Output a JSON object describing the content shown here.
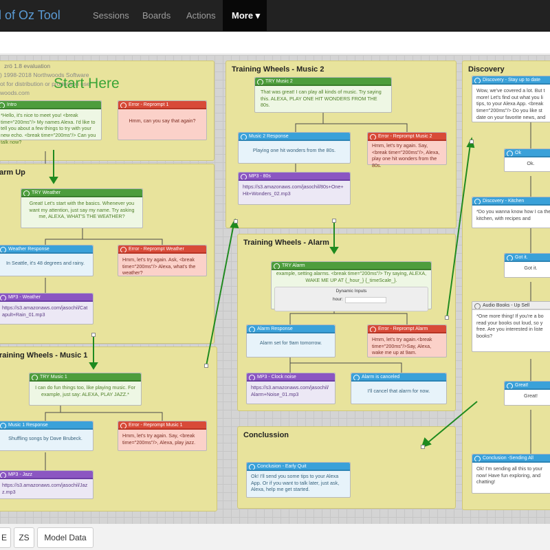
{
  "nav": {
    "brand": "d of Oz Tool",
    "items": [
      "Sessions",
      "Boards",
      "Actions"
    ],
    "active": "More ▾"
  },
  "canvas": {
    "meta": {
      "title": "zrö",
      "version": "1.8 evaluation",
      "copyright": ") 1998-2018 Northwoods Software",
      "note": "ot for distribution or production use",
      "url": "woods.com"
    },
    "start_here": "Start Here",
    "sections": {
      "intro": "",
      "alarm_up": "arm Up",
      "music1": "raining Wheels - Music 1",
      "music2": "Training Wheels - Music 2",
      "alarm": "Training Wheels - Alarm",
      "conclussion": "Conclussion",
      "discovery": "Discovery"
    },
    "cards": {
      "intro": {
        "title": "Intro",
        "body": "*Hello, it's nice to meet you! <break time=\"200ms\"/> My names Alexa. I'd like to tell you about a few things to try with your new echo. <break time=\"200ms\"/> Can you talk now?"
      },
      "err_reprompt": {
        "title": "Error - Reprompt 1",
        "body": "Hmm, can you say that again?"
      },
      "try_weather": {
        "title": "TRY Weather",
        "body": "Great! Let's start with the basics. Whenever you want my attention, just say my name. Try asking me, ALEXA, WHAT'S THE WEATHER?"
      },
      "weather_resp": {
        "title": "Weather Response",
        "body": "In Seattle, it's 48 degrees and rainy."
      },
      "err_weather": {
        "title": "Error - Reprompt Weather",
        "body": "Hmm, let's try again. Ask, <break time=\"200ms\"/> Alexa, what's the weather?"
      },
      "mp3_weather": {
        "title": "MP3 - Weather",
        "body": "https://s3.amazonaws.com/jasochil/Catapult+Rain_01.mp3"
      },
      "try_music1": {
        "title": "TRY Music 1",
        "body": "I can do fun things too, like playing music. For example, just say: ALEXA, PLAY JAZZ.*"
      },
      "music1_resp": {
        "title": "Music 1 Response",
        "body": "Shuffling songs by Dave Brubeck."
      },
      "err_music1": {
        "title": "Error - Reprompt Music 1",
        "body": "Hmm, let's try again. Say, <break time=\"200ms\"/>, Alexa, play jazz."
      },
      "mp3_jazz": {
        "title": "MP3 - Jazz",
        "body": "https://s3.amazonaws.com/jasochil/Jazz.mp3"
      },
      "try_music2": {
        "title": "TRY Music 2",
        "body": "That was great! I can play all kinds of music. Try saying this. ALEXA, PLAY ONE HIT WONDERS FROM THE 80s."
      },
      "music2_resp": {
        "title": "Music 2 Response",
        "body": "Playing one hit wonders from the 80s."
      },
      "err_music2": {
        "title": "Error - Reprompt Music 2",
        "body": "Hmm, let's try again. Say, <break time=\"200ms\"/>, Alexa, play one hit wonders from the 80s."
      },
      "mp3_80s": {
        "title": "MP3 - 80s",
        "body": "https://s3.amazonaws.com/jasochil/80s+One+Hit+Wonders_02.mp3"
      },
      "try_alarm": {
        "title": "TRY Alarm",
        "body": "example, setting alarms. <break time=\"200ms\"/> Try saying, ALEXA, WAKE ME UP AT {_hour_} {_timeScale_}.",
        "dyn_title": "Dynamic Inputs",
        "dyn_label": "hour:"
      },
      "alarm_resp": {
        "title": "Alarm Response",
        "body": "Alarm set for 9am tomorrow."
      },
      "err_alarm": {
        "title": "Error - Reprompt Alarm",
        "body": "Hmm, let's try again.<break time=\"200ms\"/>Say, Alexa, wake me up at 9am."
      },
      "mp3_clock": {
        "title": "MP3 - Clock noise",
        "body": "https://s3.amazonaws.com/jasochil/Alarm+Noise_01.mp3"
      },
      "alarm_cancel": {
        "title": "Alarm is canceled",
        "body": "I'll cancel that alarm for now."
      },
      "early_quit": {
        "title": "Conclusion - Early Quit",
        "body": "Ok! I'll send you some tips to your Alexa App. Or if you want to talk later, just ask, Alexa, help me get started."
      },
      "stay_up": {
        "title": "Discovery - Stay up to date",
        "body": "Wow, we've covered a lot. But t more! Let's find out what you li tips, to your Alexa App. <break time=\"200ms\"/> Do you like st date on your favorite news, and"
      },
      "ok": {
        "title": "Ok",
        "body": "Ok."
      },
      "kitchen": {
        "title": "Discovery - Kitchen",
        "body": "*Do you wanna know how I ca the kitchen, with recipes and"
      },
      "got_it": {
        "title": "Got it.",
        "body": "Got it."
      },
      "audio_books": {
        "title": "Audio Books - Up Sell",
        "body": "*One more thing! If you're a bo read your books out loud, so y free. Are you interested in liste books?"
      },
      "great": {
        "title": "Great!",
        "body": "Great!"
      },
      "sending_all": {
        "title": "Conclusion -Sending All",
        "body": "Ok! I'm sending all this to your now! Have fun exploring, and chatting!"
      }
    }
  },
  "footer": {
    "buttons": [
      "E",
      "ZS",
      "Model Data"
    ]
  }
}
